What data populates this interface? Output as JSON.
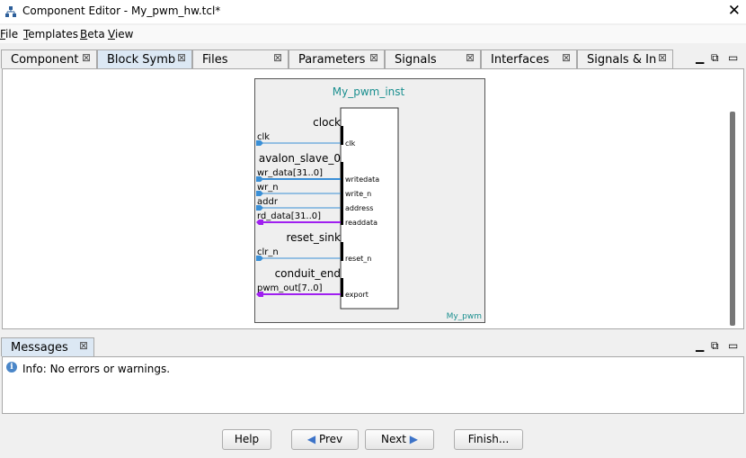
{
  "window": {
    "title": "Component Editor - My_pwm_hw.tcl*"
  },
  "menu": [
    "File",
    "Templates",
    "Beta",
    "View"
  ],
  "tabs": [
    {
      "label": "Component"
    },
    {
      "label": "Block Symb"
    },
    {
      "label": "Files"
    },
    {
      "label": "Parameters"
    },
    {
      "label": "Signals"
    },
    {
      "label": "Interfaces"
    },
    {
      "label": "Signals & In"
    }
  ],
  "symbol": {
    "instance_name": "My_pwm_inst",
    "component_name": "My_pwm",
    "interfaces": [
      "clock",
      "avalon_slave_0",
      "reset_sink",
      "conduit_end"
    ],
    "signals": [
      {
        "external": "clk",
        "port": "clk"
      },
      {
        "external": "wr_data[31..0]",
        "port": "writedata"
      },
      {
        "external": "wr_n",
        "port": "write_n"
      },
      {
        "external": "addr",
        "port": "address"
      },
      {
        "external": "rd_data[31..0]",
        "port": "readdata"
      },
      {
        "external": "clr_n",
        "port": "reset_n"
      },
      {
        "external": "pwm_out[7..0]",
        "port": "export"
      }
    ]
  },
  "messages": {
    "tab_label": "Messages",
    "text": "Info: No errors or warnings."
  },
  "buttons": {
    "help": "Help",
    "prev": "Prev",
    "next": "Next",
    "finish": "Finish..."
  },
  "colors": {
    "signal_line": "#3a8fd6",
    "output_line": "#a020f0",
    "instance_title": "#1a8f8f",
    "active_tab": "#dce8f4"
  }
}
